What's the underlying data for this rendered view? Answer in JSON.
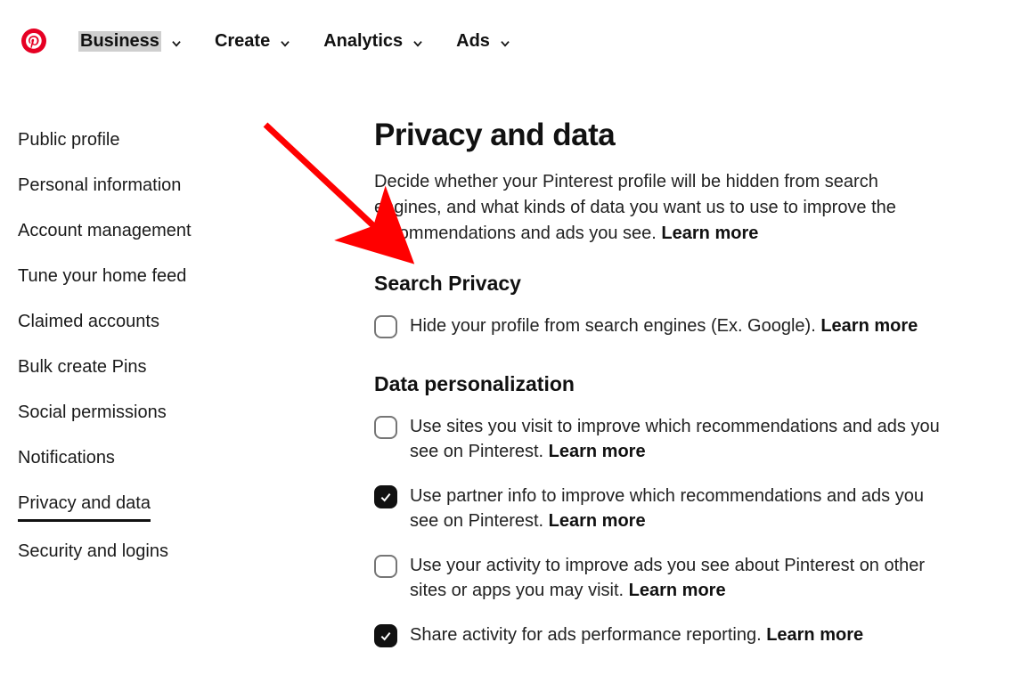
{
  "nav": {
    "items": [
      {
        "label": "Business",
        "selected": true
      },
      {
        "label": "Create",
        "selected": false
      },
      {
        "label": "Analytics",
        "selected": false
      },
      {
        "label": "Ads",
        "selected": false
      }
    ]
  },
  "sidebar": {
    "items": [
      {
        "label": "Public profile",
        "active": false
      },
      {
        "label": "Personal information",
        "active": false
      },
      {
        "label": "Account management",
        "active": false
      },
      {
        "label": "Tune your home feed",
        "active": false
      },
      {
        "label": "Claimed accounts",
        "active": false
      },
      {
        "label": "Bulk create Pins",
        "active": false
      },
      {
        "label": "Social permissions",
        "active": false
      },
      {
        "label": "Notifications",
        "active": false
      },
      {
        "label": "Privacy and data",
        "active": true
      },
      {
        "label": "Security and logins",
        "active": false
      }
    ]
  },
  "main": {
    "title": "Privacy and data",
    "description": "Decide whether your Pinterest profile will be hidden from search engines, and what kinds of data you want us to use to improve the recommendations and ads you see. ",
    "learn_more": "Learn more",
    "search_privacy": {
      "heading": "Search Privacy",
      "option": {
        "text": "Hide your profile from search engines (Ex. Google). ",
        "learn": "Learn more",
        "checked": false
      }
    },
    "data_personalization": {
      "heading": "Data personalization",
      "options": [
        {
          "text": "Use sites you visit to improve which recommendations and ads you see on Pinterest. ",
          "learn": "Learn more",
          "checked": false
        },
        {
          "text": "Use partner info to improve which recommendations and ads you see on Pinterest. ",
          "learn": "Learn more",
          "checked": true
        },
        {
          "text": "Use your activity to improve ads you see about Pinterest on other sites or apps you may visit. ",
          "learn": "Learn more",
          "checked": false
        },
        {
          "text": "Share activity for ads performance reporting. ",
          "learn": "Learn more",
          "checked": true
        }
      ]
    }
  },
  "annotation": {
    "type": "arrow",
    "color": "#ff0000"
  }
}
